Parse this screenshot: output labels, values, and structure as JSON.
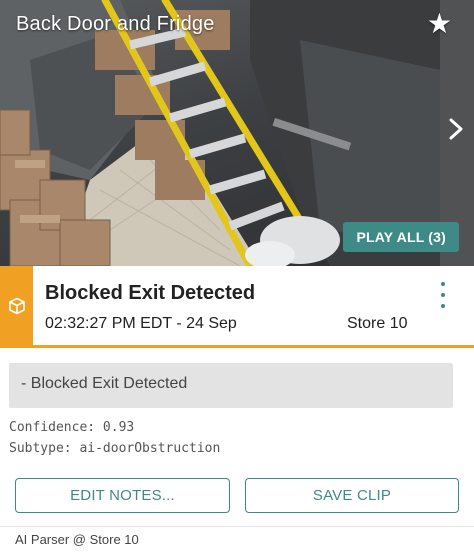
{
  "camera": {
    "title": "Back Door and Fridge",
    "favorite_icon": "star-icon",
    "next_icon": "chevron-right-icon",
    "play_all_label": "PLAY ALL (3)"
  },
  "event": {
    "icon": "cube-icon",
    "title": "Blocked Exit Detected",
    "time": "02:32:27 PM EDT - 24 Sep",
    "store": "Store 10",
    "menu_icon": "more-vertical-icon"
  },
  "notes": {
    "text": "- Blocked Exit Detected"
  },
  "details": {
    "confidence": "Confidence: 0.93",
    "subtype": "Subtype: ai-doorObstruction"
  },
  "actions": {
    "edit_notes_label": "EDIT NOTES...",
    "save_clip_label": "SAVE CLIP"
  },
  "footer": {
    "source": "AI Parser @ Store 10"
  },
  "colors": {
    "accent": "#3d8a86",
    "event_alert": "#f0a022"
  }
}
